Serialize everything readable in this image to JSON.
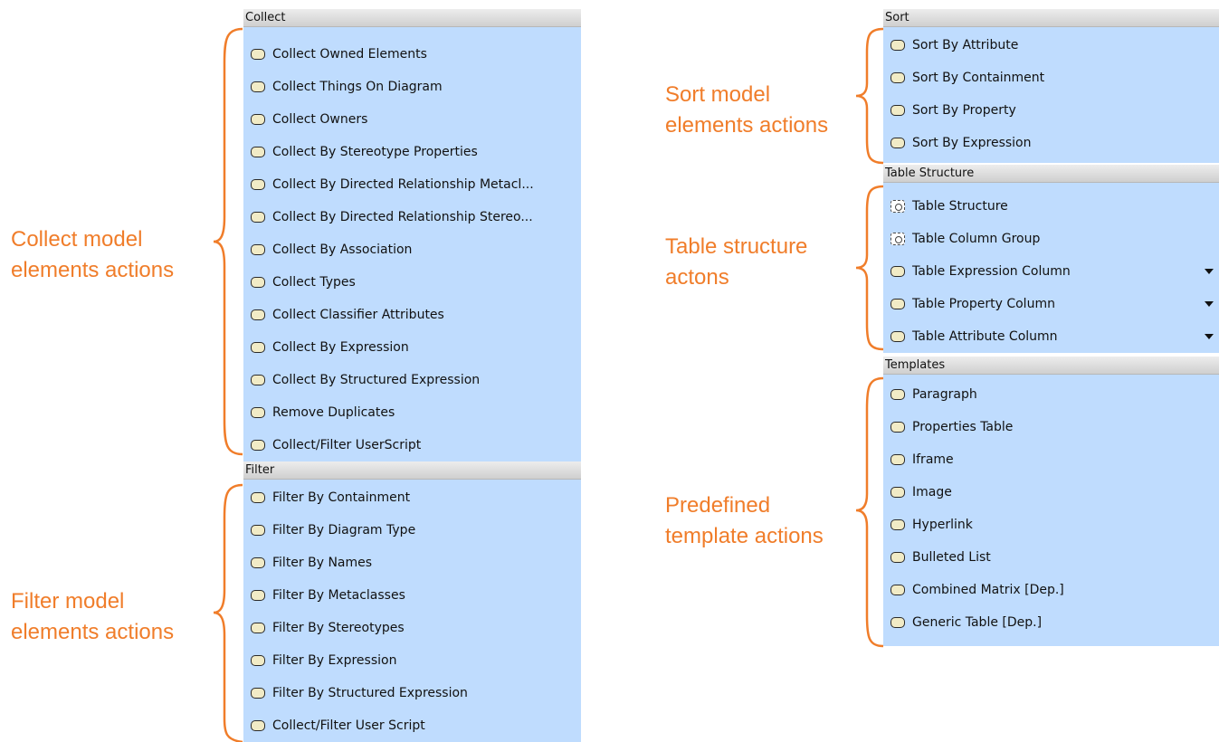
{
  "panels": {
    "collect": {
      "header": "Collect",
      "items": [
        {
          "label": "Collect Owned Elements"
        },
        {
          "label": "Collect Things On Diagram"
        },
        {
          "label": "Collect Owners"
        },
        {
          "label": "Collect By Stereotype Properties"
        },
        {
          "label": "Collect By Directed Relationship Metacl..."
        },
        {
          "label": "Collect By Directed Relationship Stereo..."
        },
        {
          "label": "Collect By Association"
        },
        {
          "label": "Collect Types"
        },
        {
          "label": "Collect Classifier Attributes"
        },
        {
          "label": "Collect By Expression"
        },
        {
          "label": "Collect By Structured Expression"
        },
        {
          "label": "Remove Duplicates"
        },
        {
          "label": "Collect/Filter UserScript"
        }
      ]
    },
    "filter": {
      "header": "Filter",
      "items": [
        {
          "label": "Filter By Containment"
        },
        {
          "label": "Filter By Diagram Type"
        },
        {
          "label": "Filter By Names"
        },
        {
          "label": "Filter By Metaclasses"
        },
        {
          "label": "Filter By Stereotypes"
        },
        {
          "label": "Filter By Expression"
        },
        {
          "label": "Filter By Structured Expression"
        },
        {
          "label": "Collect/Filter User Script"
        }
      ]
    },
    "sort": {
      "header": "Sort",
      "items": [
        {
          "label": "Sort By Attribute"
        },
        {
          "label": "Sort By Containment"
        },
        {
          "label": "Sort By Property"
        },
        {
          "label": "Sort By Expression"
        }
      ]
    },
    "table_structure": {
      "header": "Table Structure",
      "items": [
        {
          "label": "Table Structure",
          "icon": "structure-icon"
        },
        {
          "label": "Table Column Group",
          "icon": "structure-icon"
        },
        {
          "label": "Table Expression Column",
          "icon": "action-icon",
          "dropdown": true
        },
        {
          "label": "Table Property Column",
          "icon": "action-icon",
          "dropdown": true
        },
        {
          "label": "Table Attribute Column",
          "icon": "action-icon",
          "dropdown": true
        }
      ]
    },
    "templates": {
      "header": "Templates",
      "items": [
        {
          "label": "Paragraph"
        },
        {
          "label": "Properties Table"
        },
        {
          "label": "Iframe"
        },
        {
          "label": "Image"
        },
        {
          "label": "Hyperlink"
        },
        {
          "label": "Bulleted List"
        },
        {
          "label": "Combined Matrix [Dep.]"
        },
        {
          "label": "Generic Table [Dep.]"
        }
      ]
    }
  },
  "annotations": {
    "collect": [
      "Collect model",
      "elements actions"
    ],
    "filter": [
      "Filter model",
      "elements actions"
    ],
    "sort": [
      "Sort model",
      "elements actions"
    ],
    "table": [
      "Table structure",
      "actons"
    ],
    "templates": [
      "Predefined",
      "template actions"
    ]
  },
  "colors": {
    "accent": "#f07d2a",
    "list_background": "#bfdcfe",
    "icon_fill": "#f1ebc6"
  }
}
